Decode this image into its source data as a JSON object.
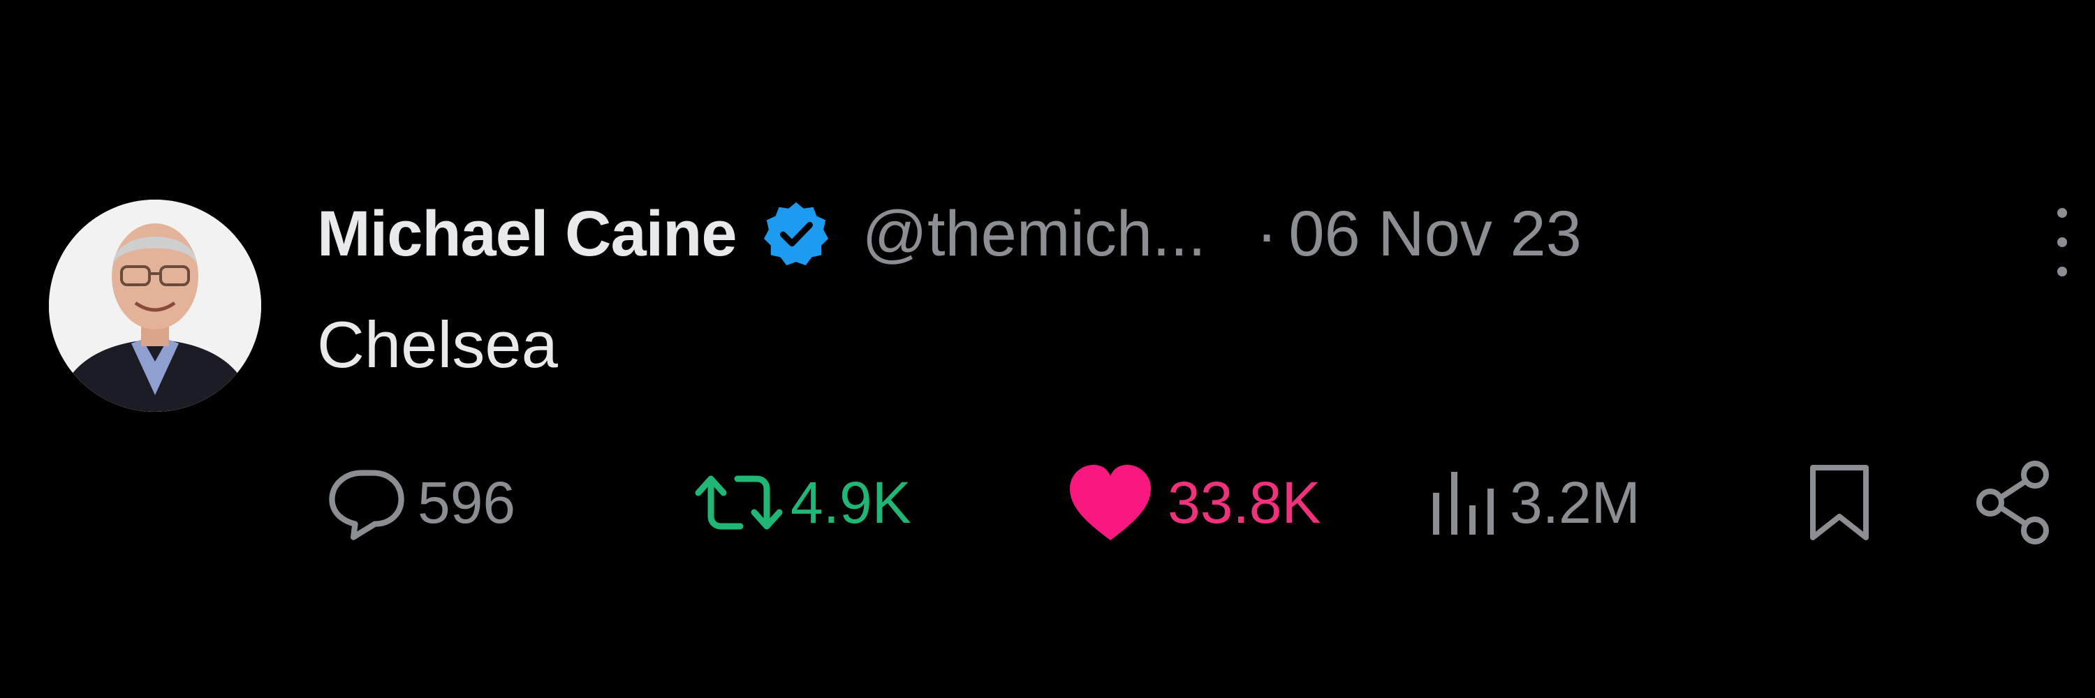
{
  "tweet": {
    "author_name": "Michael Caine",
    "verified": true,
    "handle": "@themich...",
    "separator": "·",
    "date": "06 Nov 23",
    "text": "Chelsea"
  },
  "actions": {
    "replies": "596",
    "reposts": "4.9K",
    "likes": "33.8K",
    "views": "3.2M"
  },
  "icons": {
    "avatar": "avatar-photo",
    "verified": "verified-badge-icon",
    "more": "more-options-icon",
    "reply": "reply-icon",
    "repost": "repost-icon",
    "like": "heart-icon",
    "views": "views-icon",
    "bookmark": "bookmark-icon",
    "share": "share-icon"
  },
  "colors": {
    "background": "#000000",
    "primary_text": "#e7e9ea",
    "secondary_text": "#8b8f94",
    "verified_blue": "#1d9bf0",
    "repost_green": "#1fb676",
    "like_pink": "#f0327e"
  }
}
